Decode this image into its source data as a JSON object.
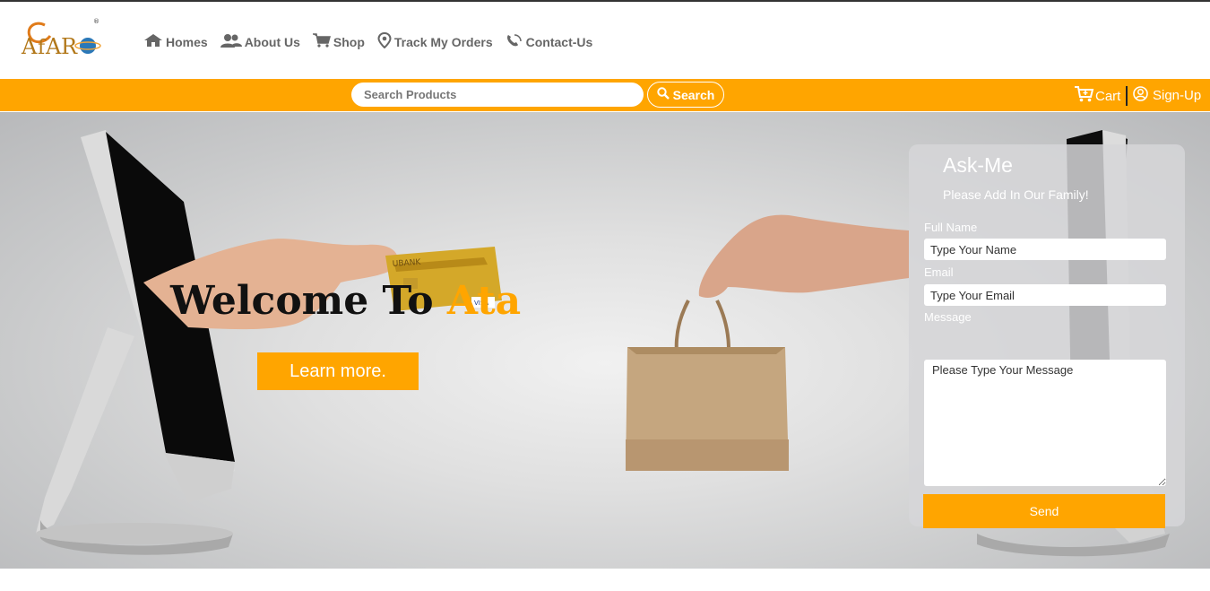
{
  "logo": {
    "text": "AfARO",
    "registered": "®"
  },
  "nav": {
    "items": [
      {
        "label": "Homes",
        "icon": "home-icon"
      },
      {
        "label": "About Us",
        "icon": "users-icon"
      },
      {
        "label": "Shop",
        "icon": "cart-icon"
      },
      {
        "label": "Track My Orders",
        "icon": "map-pin-icon"
      },
      {
        "label": "Contact-Us",
        "icon": "phone-icon"
      }
    ]
  },
  "search": {
    "placeholder": "Search Products",
    "value": "",
    "button_label": "Search"
  },
  "account": {
    "cart_label": "Cart",
    "signup_label": "Sign-Up"
  },
  "hero": {
    "welcome_prefix": "Welcome To",
    "welcome_brand": "Ata",
    "learn_label": "Learn more.",
    "card_bank": "UBANK",
    "card_brand": "VISA"
  },
  "ask": {
    "title": "Ask-Me",
    "subtitle": "Please Add In Our Family!",
    "name_label": "Full Name",
    "name_placeholder": "Type Your Name",
    "email_label": "Email",
    "email_placeholder": "Type Your Email",
    "message_label": "Message",
    "message_placeholder": "Please Type Your Message",
    "send_label": "Send"
  },
  "colors": {
    "accent": "#ffa500",
    "nav_text": "#666666",
    "header_line": "#333333"
  }
}
